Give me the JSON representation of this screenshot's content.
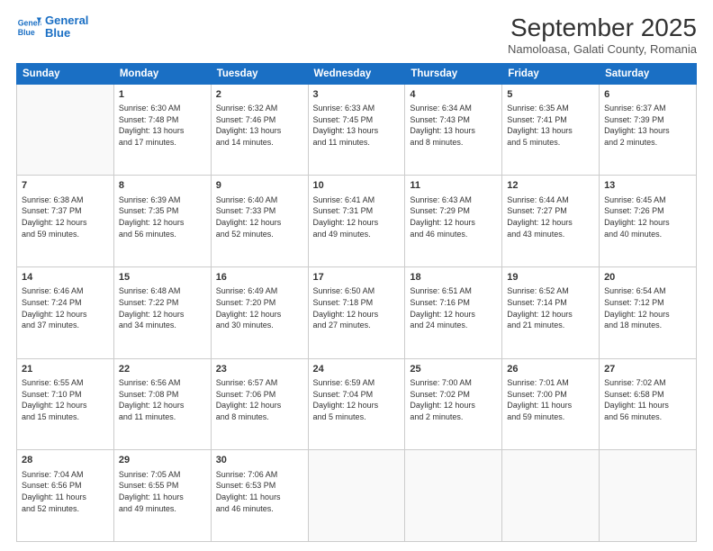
{
  "logo": {
    "line1": "General",
    "line2": "Blue"
  },
  "title": "September 2025",
  "subtitle": "Namoloasa, Galati County, Romania",
  "days": [
    "Sunday",
    "Monday",
    "Tuesday",
    "Wednesday",
    "Thursday",
    "Friday",
    "Saturday"
  ],
  "weeks": [
    [
      {
        "day": "",
        "info": ""
      },
      {
        "day": "1",
        "info": "Sunrise: 6:30 AM\nSunset: 7:48 PM\nDaylight: 13 hours\nand 17 minutes."
      },
      {
        "day": "2",
        "info": "Sunrise: 6:32 AM\nSunset: 7:46 PM\nDaylight: 13 hours\nand 14 minutes."
      },
      {
        "day": "3",
        "info": "Sunrise: 6:33 AM\nSunset: 7:45 PM\nDaylight: 13 hours\nand 11 minutes."
      },
      {
        "day": "4",
        "info": "Sunrise: 6:34 AM\nSunset: 7:43 PM\nDaylight: 13 hours\nand 8 minutes."
      },
      {
        "day": "5",
        "info": "Sunrise: 6:35 AM\nSunset: 7:41 PM\nDaylight: 13 hours\nand 5 minutes."
      },
      {
        "day": "6",
        "info": "Sunrise: 6:37 AM\nSunset: 7:39 PM\nDaylight: 13 hours\nand 2 minutes."
      }
    ],
    [
      {
        "day": "7",
        "info": "Sunrise: 6:38 AM\nSunset: 7:37 PM\nDaylight: 12 hours\nand 59 minutes."
      },
      {
        "day": "8",
        "info": "Sunrise: 6:39 AM\nSunset: 7:35 PM\nDaylight: 12 hours\nand 56 minutes."
      },
      {
        "day": "9",
        "info": "Sunrise: 6:40 AM\nSunset: 7:33 PM\nDaylight: 12 hours\nand 52 minutes."
      },
      {
        "day": "10",
        "info": "Sunrise: 6:41 AM\nSunset: 7:31 PM\nDaylight: 12 hours\nand 49 minutes."
      },
      {
        "day": "11",
        "info": "Sunrise: 6:43 AM\nSunset: 7:29 PM\nDaylight: 12 hours\nand 46 minutes."
      },
      {
        "day": "12",
        "info": "Sunrise: 6:44 AM\nSunset: 7:27 PM\nDaylight: 12 hours\nand 43 minutes."
      },
      {
        "day": "13",
        "info": "Sunrise: 6:45 AM\nSunset: 7:26 PM\nDaylight: 12 hours\nand 40 minutes."
      }
    ],
    [
      {
        "day": "14",
        "info": "Sunrise: 6:46 AM\nSunset: 7:24 PM\nDaylight: 12 hours\nand 37 minutes."
      },
      {
        "day": "15",
        "info": "Sunrise: 6:48 AM\nSunset: 7:22 PM\nDaylight: 12 hours\nand 34 minutes."
      },
      {
        "day": "16",
        "info": "Sunrise: 6:49 AM\nSunset: 7:20 PM\nDaylight: 12 hours\nand 30 minutes."
      },
      {
        "day": "17",
        "info": "Sunrise: 6:50 AM\nSunset: 7:18 PM\nDaylight: 12 hours\nand 27 minutes."
      },
      {
        "day": "18",
        "info": "Sunrise: 6:51 AM\nSunset: 7:16 PM\nDaylight: 12 hours\nand 24 minutes."
      },
      {
        "day": "19",
        "info": "Sunrise: 6:52 AM\nSunset: 7:14 PM\nDaylight: 12 hours\nand 21 minutes."
      },
      {
        "day": "20",
        "info": "Sunrise: 6:54 AM\nSunset: 7:12 PM\nDaylight: 12 hours\nand 18 minutes."
      }
    ],
    [
      {
        "day": "21",
        "info": "Sunrise: 6:55 AM\nSunset: 7:10 PM\nDaylight: 12 hours\nand 15 minutes."
      },
      {
        "day": "22",
        "info": "Sunrise: 6:56 AM\nSunset: 7:08 PM\nDaylight: 12 hours\nand 11 minutes."
      },
      {
        "day": "23",
        "info": "Sunrise: 6:57 AM\nSunset: 7:06 PM\nDaylight: 12 hours\nand 8 minutes."
      },
      {
        "day": "24",
        "info": "Sunrise: 6:59 AM\nSunset: 7:04 PM\nDaylight: 12 hours\nand 5 minutes."
      },
      {
        "day": "25",
        "info": "Sunrise: 7:00 AM\nSunset: 7:02 PM\nDaylight: 12 hours\nand 2 minutes."
      },
      {
        "day": "26",
        "info": "Sunrise: 7:01 AM\nSunset: 7:00 PM\nDaylight: 11 hours\nand 59 minutes."
      },
      {
        "day": "27",
        "info": "Sunrise: 7:02 AM\nSunset: 6:58 PM\nDaylight: 11 hours\nand 56 minutes."
      }
    ],
    [
      {
        "day": "28",
        "info": "Sunrise: 7:04 AM\nSunset: 6:56 PM\nDaylight: 11 hours\nand 52 minutes."
      },
      {
        "day": "29",
        "info": "Sunrise: 7:05 AM\nSunset: 6:55 PM\nDaylight: 11 hours\nand 49 minutes."
      },
      {
        "day": "30",
        "info": "Sunrise: 7:06 AM\nSunset: 6:53 PM\nDaylight: 11 hours\nand 46 minutes."
      },
      {
        "day": "",
        "info": ""
      },
      {
        "day": "",
        "info": ""
      },
      {
        "day": "",
        "info": ""
      },
      {
        "day": "",
        "info": ""
      }
    ]
  ]
}
